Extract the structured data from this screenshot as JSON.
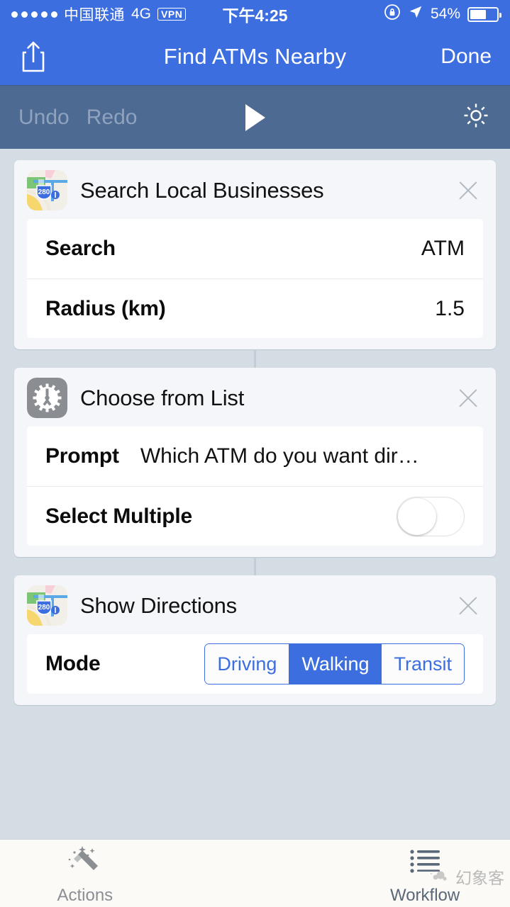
{
  "status_bar": {
    "signal_dots": 5,
    "carrier": "中国联通",
    "network": "4G",
    "vpn": "VPN",
    "time": "下午4:25",
    "rotation_lock_icon": "rotation-lock-icon",
    "location_icon": "location-arrow-icon",
    "battery_percent": "54%",
    "battery_level": 54
  },
  "nav_bar": {
    "share_icon": "share-icon",
    "title": "Find ATMs Nearby",
    "done_label": "Done"
  },
  "toolbar": {
    "undo_label": "Undo",
    "redo_label": "Redo",
    "play_icon": "play-icon",
    "settings_icon": "gear-icon"
  },
  "colors": {
    "nav_blue": "#3d6ee0",
    "toolbar_blue": "#4d6a92",
    "page_background": "#d5dde4",
    "card_background": "#f4f6f9",
    "accent": "#3d6ee0"
  },
  "actions": [
    {
      "icon": "maps-app-icon",
      "title": "Search Local Businesses",
      "close_icon": "close-icon",
      "params": [
        {
          "type": "value",
          "label": "Search",
          "value": "ATM"
        },
        {
          "type": "value",
          "label": "Radius (km)",
          "value": "1.5"
        }
      ]
    },
    {
      "icon": "gear-app-icon",
      "title": "Choose from List",
      "close_icon": "close-icon",
      "params": [
        {
          "type": "inline",
          "label": "Prompt",
          "value": "Which ATM do you want dir…"
        },
        {
          "type": "toggle",
          "label": "Select Multiple",
          "value": "off"
        }
      ]
    },
    {
      "icon": "maps-app-icon",
      "title": "Show Directions",
      "close_icon": "close-icon",
      "params": [
        {
          "type": "segmented",
          "label": "Mode",
          "options": [
            "Driving",
            "Walking",
            "Transit"
          ],
          "selected": "Walking"
        }
      ]
    }
  ],
  "tab_bar": {
    "tabs": [
      {
        "icon": "magic-wand-icon",
        "label": "Actions",
        "active": false
      },
      {
        "icon": "list-icon",
        "label": "Workflow",
        "active": true
      }
    ]
  },
  "watermark": {
    "text": "幻象客"
  }
}
